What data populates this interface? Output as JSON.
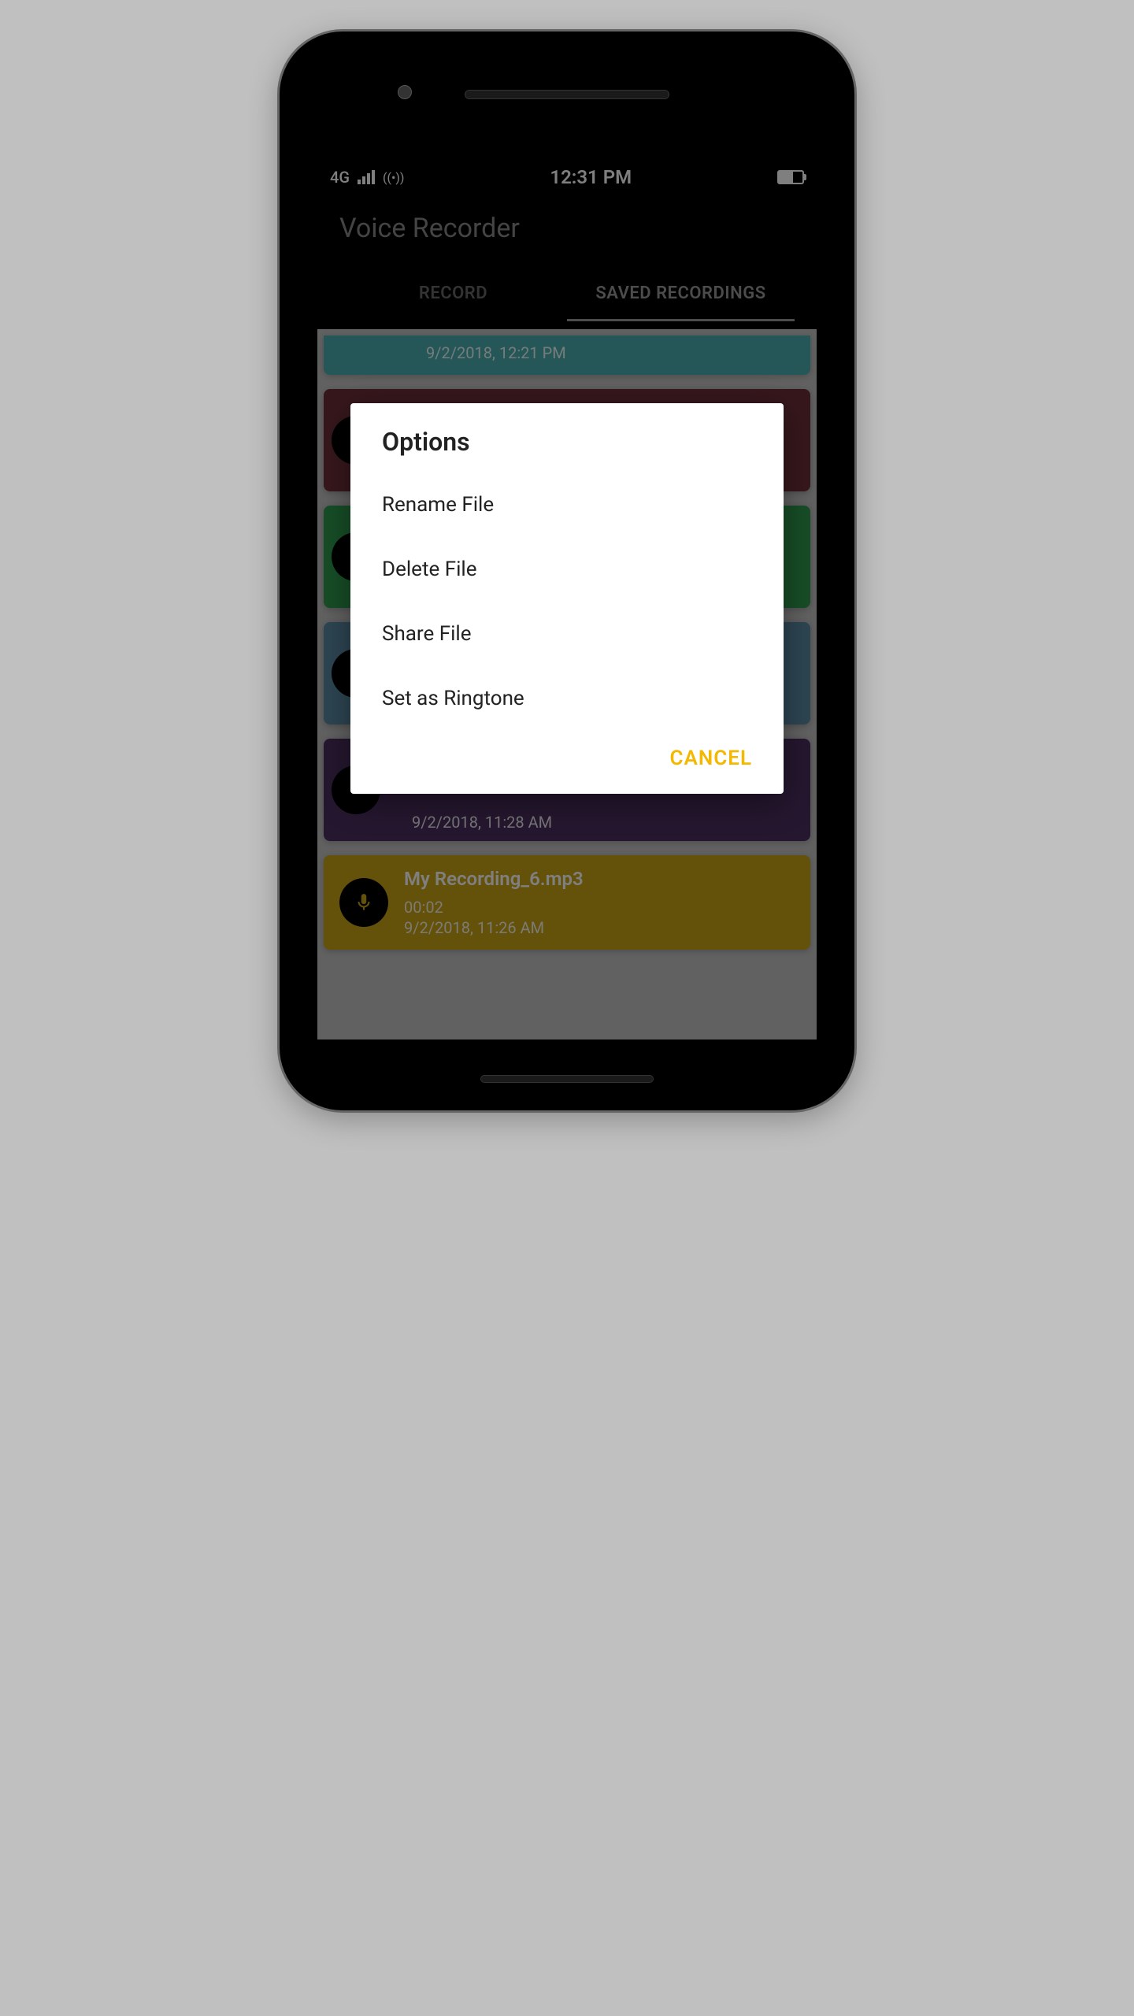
{
  "status_bar": {
    "network": "4G",
    "time": "12:31 PM"
  },
  "app": {
    "title": "Voice Recorder"
  },
  "tabs": {
    "record": "RECORD",
    "saved": "SAVED RECORDINGS"
  },
  "recordings": {
    "partial_top_date": "9/2/2018, 12:21 PM",
    "partial_bottom_date": "9/2/2018, 11:28 AM",
    "item6": {
      "title": "My Recording_6.mp3",
      "duration": "00:02",
      "date": "9/2/2018, 11:26 AM"
    }
  },
  "dialog": {
    "title": "Options",
    "options": {
      "rename": "Rename File",
      "delete": "Delete File",
      "share": "Share File",
      "ringtone": "Set as Ringtone"
    },
    "cancel": "CANCEL"
  },
  "colors": {
    "teal": "#4aafb0",
    "maroon": "#6d2e38",
    "green": "#2e9b4f",
    "blue": "#5a8aa5",
    "purple": "#4a2e5e",
    "yellow": "#c9a215",
    "accent": "#f5b800"
  }
}
